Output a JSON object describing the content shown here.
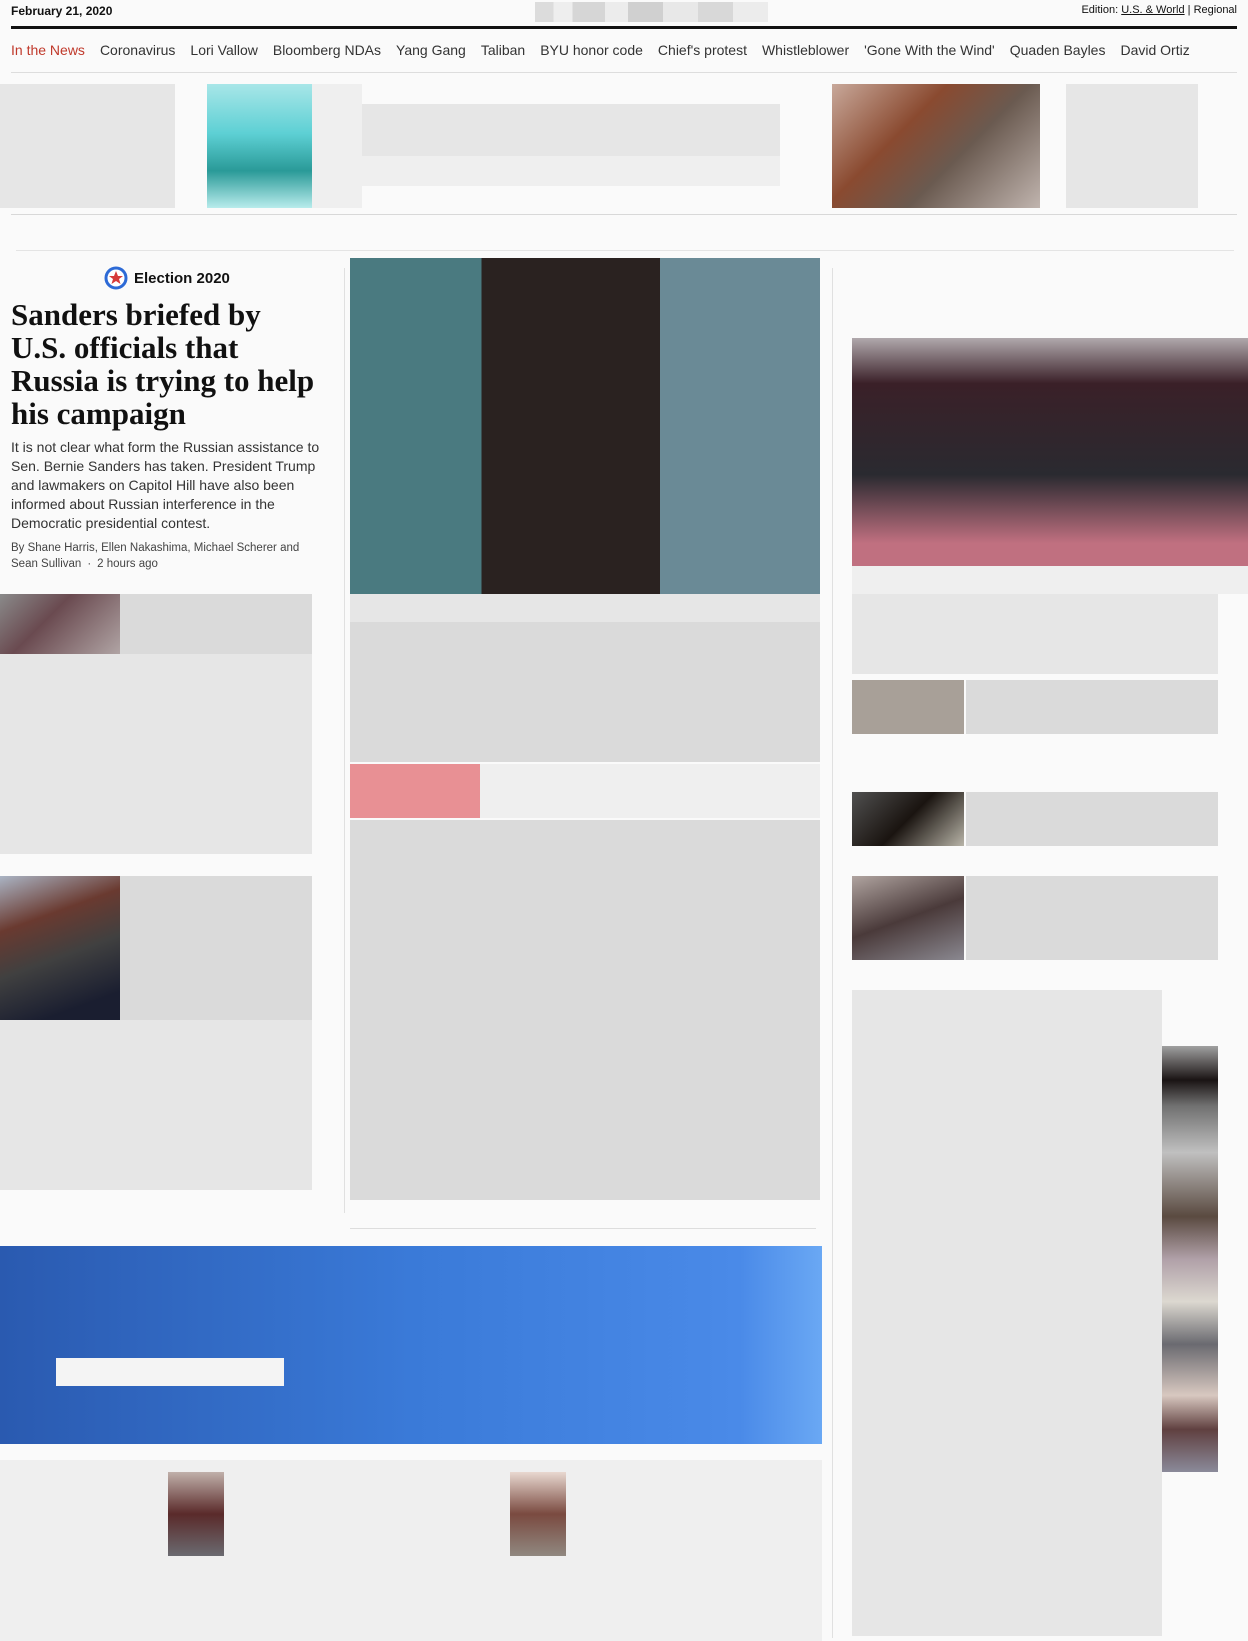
{
  "header": {
    "date": "February 21, 2020",
    "edition_label": "Edition:",
    "edition_current": "U.S. & World",
    "edition_separator": "|",
    "edition_alt": "Regional"
  },
  "trending": {
    "items": [
      "In the News",
      "Coronavirus",
      "Lori Vallow",
      "Bloomberg NDAs",
      "Yang Gang",
      "Taliban",
      "BYU honor code",
      "Chief's protest",
      "Whistleblower",
      "'Gone With the Wind'",
      "Quaden Bayles",
      "David Ortiz"
    ]
  },
  "lead_story": {
    "kicker": "Election 2020",
    "headline": "Sanders briefed by U.S. officials that Russia is trying to help his campaign",
    "blurb": "It is not clear what form the Russian assistance to Sen. Bernie Sanders has taken. President Trump and lawmakers on Capitol Hill have also been informed about Russian interference in the Democratic presidential contest.",
    "byline": "By Shane Harris, Ellen Nakashima, Michael Scherer and Sean Sullivan",
    "timestamp": "2 hours ago"
  },
  "colors": {
    "accent_red": "#c0392b",
    "promo_blue": "#3a7ad8",
    "logo_blue": "#2d6ad6",
    "logo_red": "#d63a3a"
  }
}
